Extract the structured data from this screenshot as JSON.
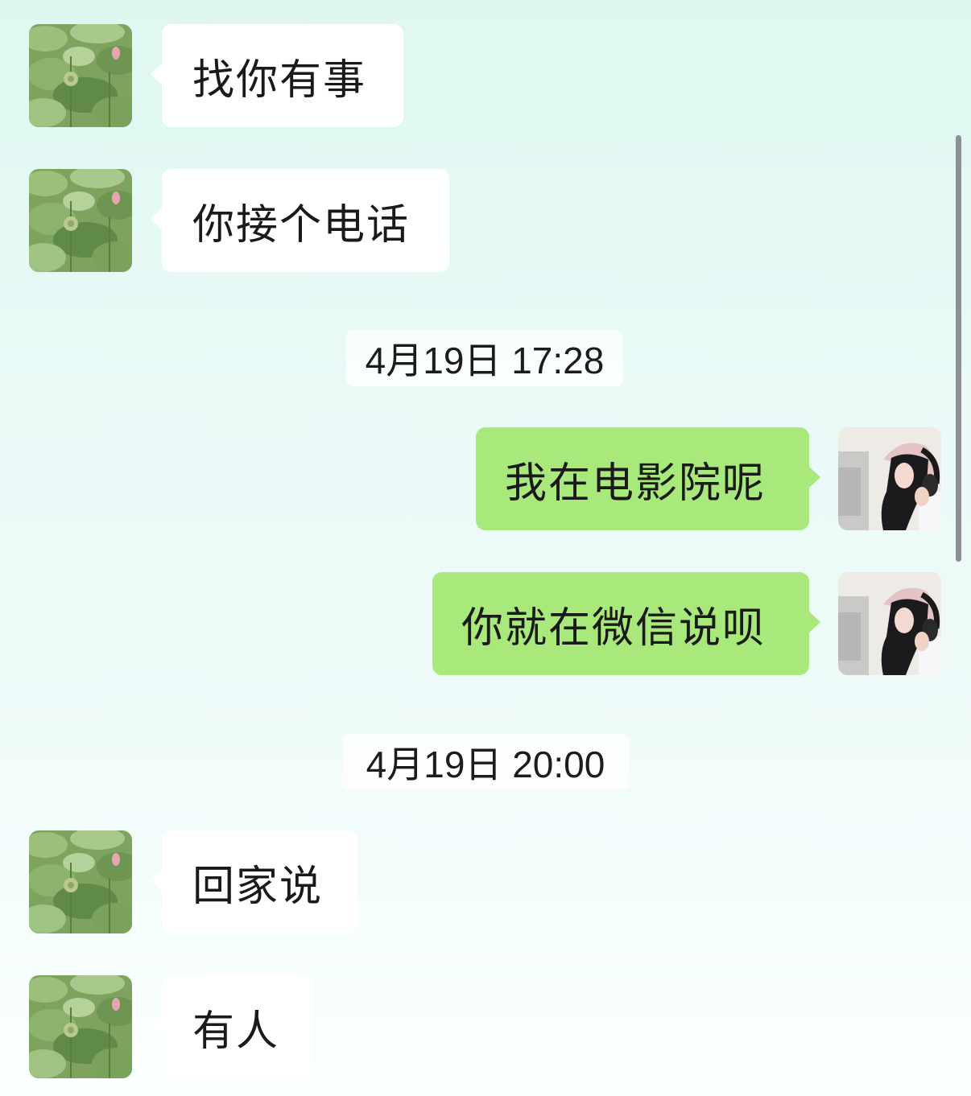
{
  "conversation": {
    "messages": [
      {
        "direction": "incoming",
        "text": "找你有事",
        "avatar": "lotus-leaves-avatar"
      },
      {
        "direction": "incoming",
        "text": "你接个电话",
        "avatar": "lotus-leaves-avatar"
      },
      {
        "direction": "outgoing",
        "text": "我在电影院呢",
        "avatar": "girl-with-headphones-avatar"
      },
      {
        "direction": "outgoing",
        "text": "你就在微信说呗",
        "avatar": "girl-with-headphones-avatar"
      },
      {
        "direction": "incoming",
        "text": "回家说",
        "avatar": "lotus-leaves-avatar"
      },
      {
        "direction": "incoming",
        "text": "有人",
        "avatar": "lotus-leaves-avatar"
      }
    ],
    "timestamps": [
      "4月19日 17:28",
      "4月19日 20:00"
    ]
  },
  "colors": {
    "incoming_bubble": "#ffffff",
    "outgoing_bubble": "#a9e87a",
    "background_top": "#dff7f1",
    "background_bottom": "#fbffff",
    "scrollbar": "#8c8f93"
  }
}
